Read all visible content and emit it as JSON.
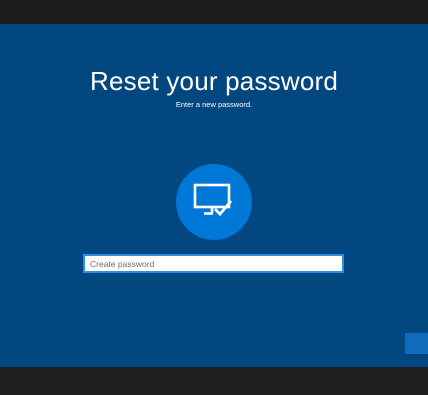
{
  "reset": {
    "title": "Reset your password",
    "subtitle": "Enter a new password.",
    "device_icon": "monitor-check-icon",
    "password_field": {
      "placeholder": "Create password",
      "value": ""
    }
  },
  "colors": {
    "screen_background": "#034780",
    "avatar_circle": "#0078d7",
    "field_border": "#2c8ee6",
    "submit_button": "#0f6cbd"
  }
}
